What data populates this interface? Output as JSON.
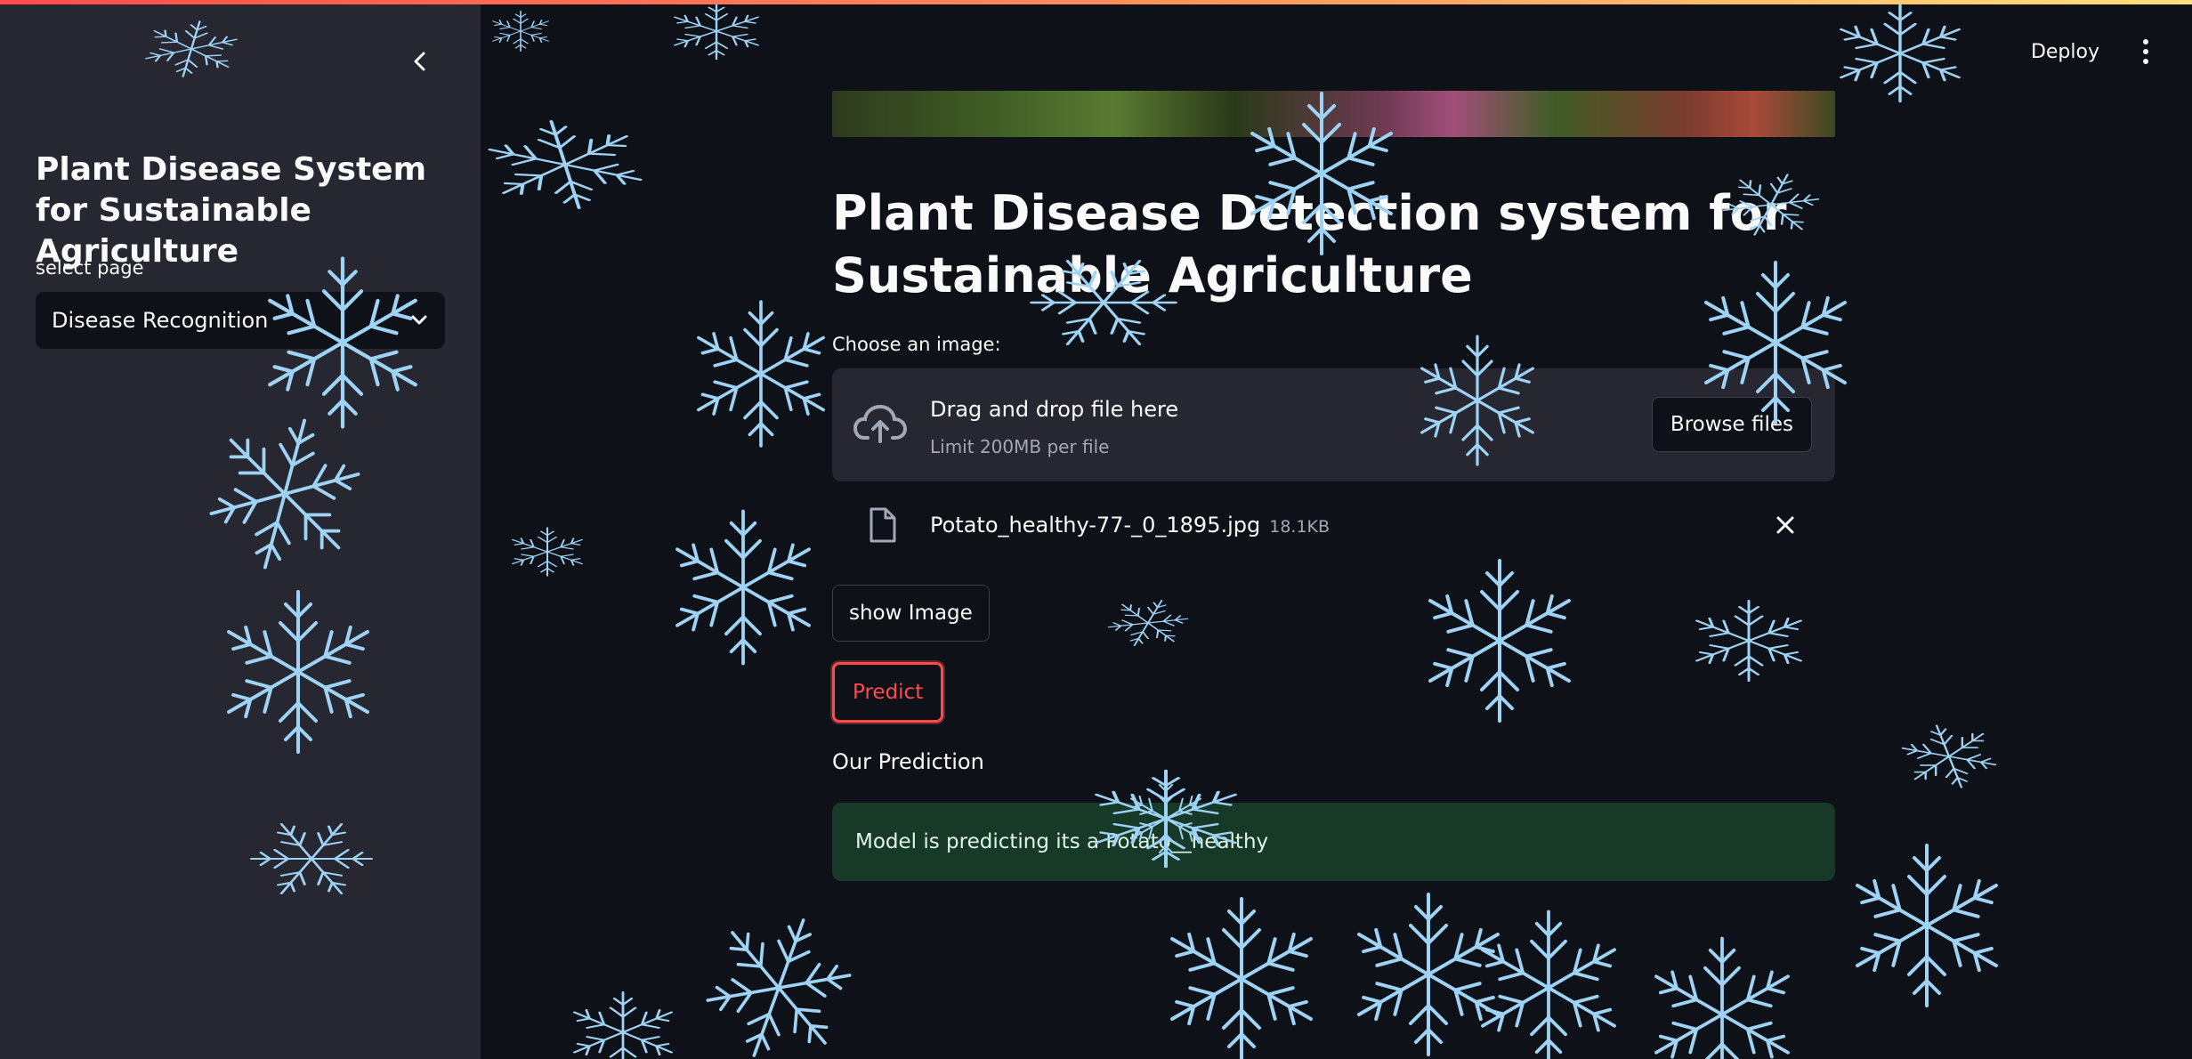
{
  "sidebar": {
    "title": "Plant Disease System for Sustainable Agriculture",
    "select_label": "select page",
    "selected_page": "Disease Recognition"
  },
  "header": {
    "deploy_label": "Deploy"
  },
  "main": {
    "title": "Plant Disease Detection system for Sustainable Agriculture",
    "uploader": {
      "label": "Choose an image:",
      "drag_text": "Drag and drop file here",
      "limit_text": "Limit 200MB per file",
      "browse_label": "Browse files"
    },
    "file": {
      "name": "Potato_healthy-77-_0_1895.jpg",
      "size": "18.1KB"
    },
    "show_image_label": "show Image",
    "predict_label": "Predict",
    "prediction_heading": "Our Prediction",
    "prediction_result": "Model is predicting its a Potato__healthy"
  },
  "colors": {
    "background": "#0e1117",
    "sidebar": "#262730",
    "accent": "#ff4b4b",
    "success_bg": "#173928",
    "snowflake": "#9fd3f5"
  },
  "icons": [
    "chevron-left-icon",
    "chevron-down-icon",
    "kebab-menu-icon",
    "cloud-upload-icon",
    "file-icon",
    "close-icon",
    "snowflake-icon"
  ]
}
